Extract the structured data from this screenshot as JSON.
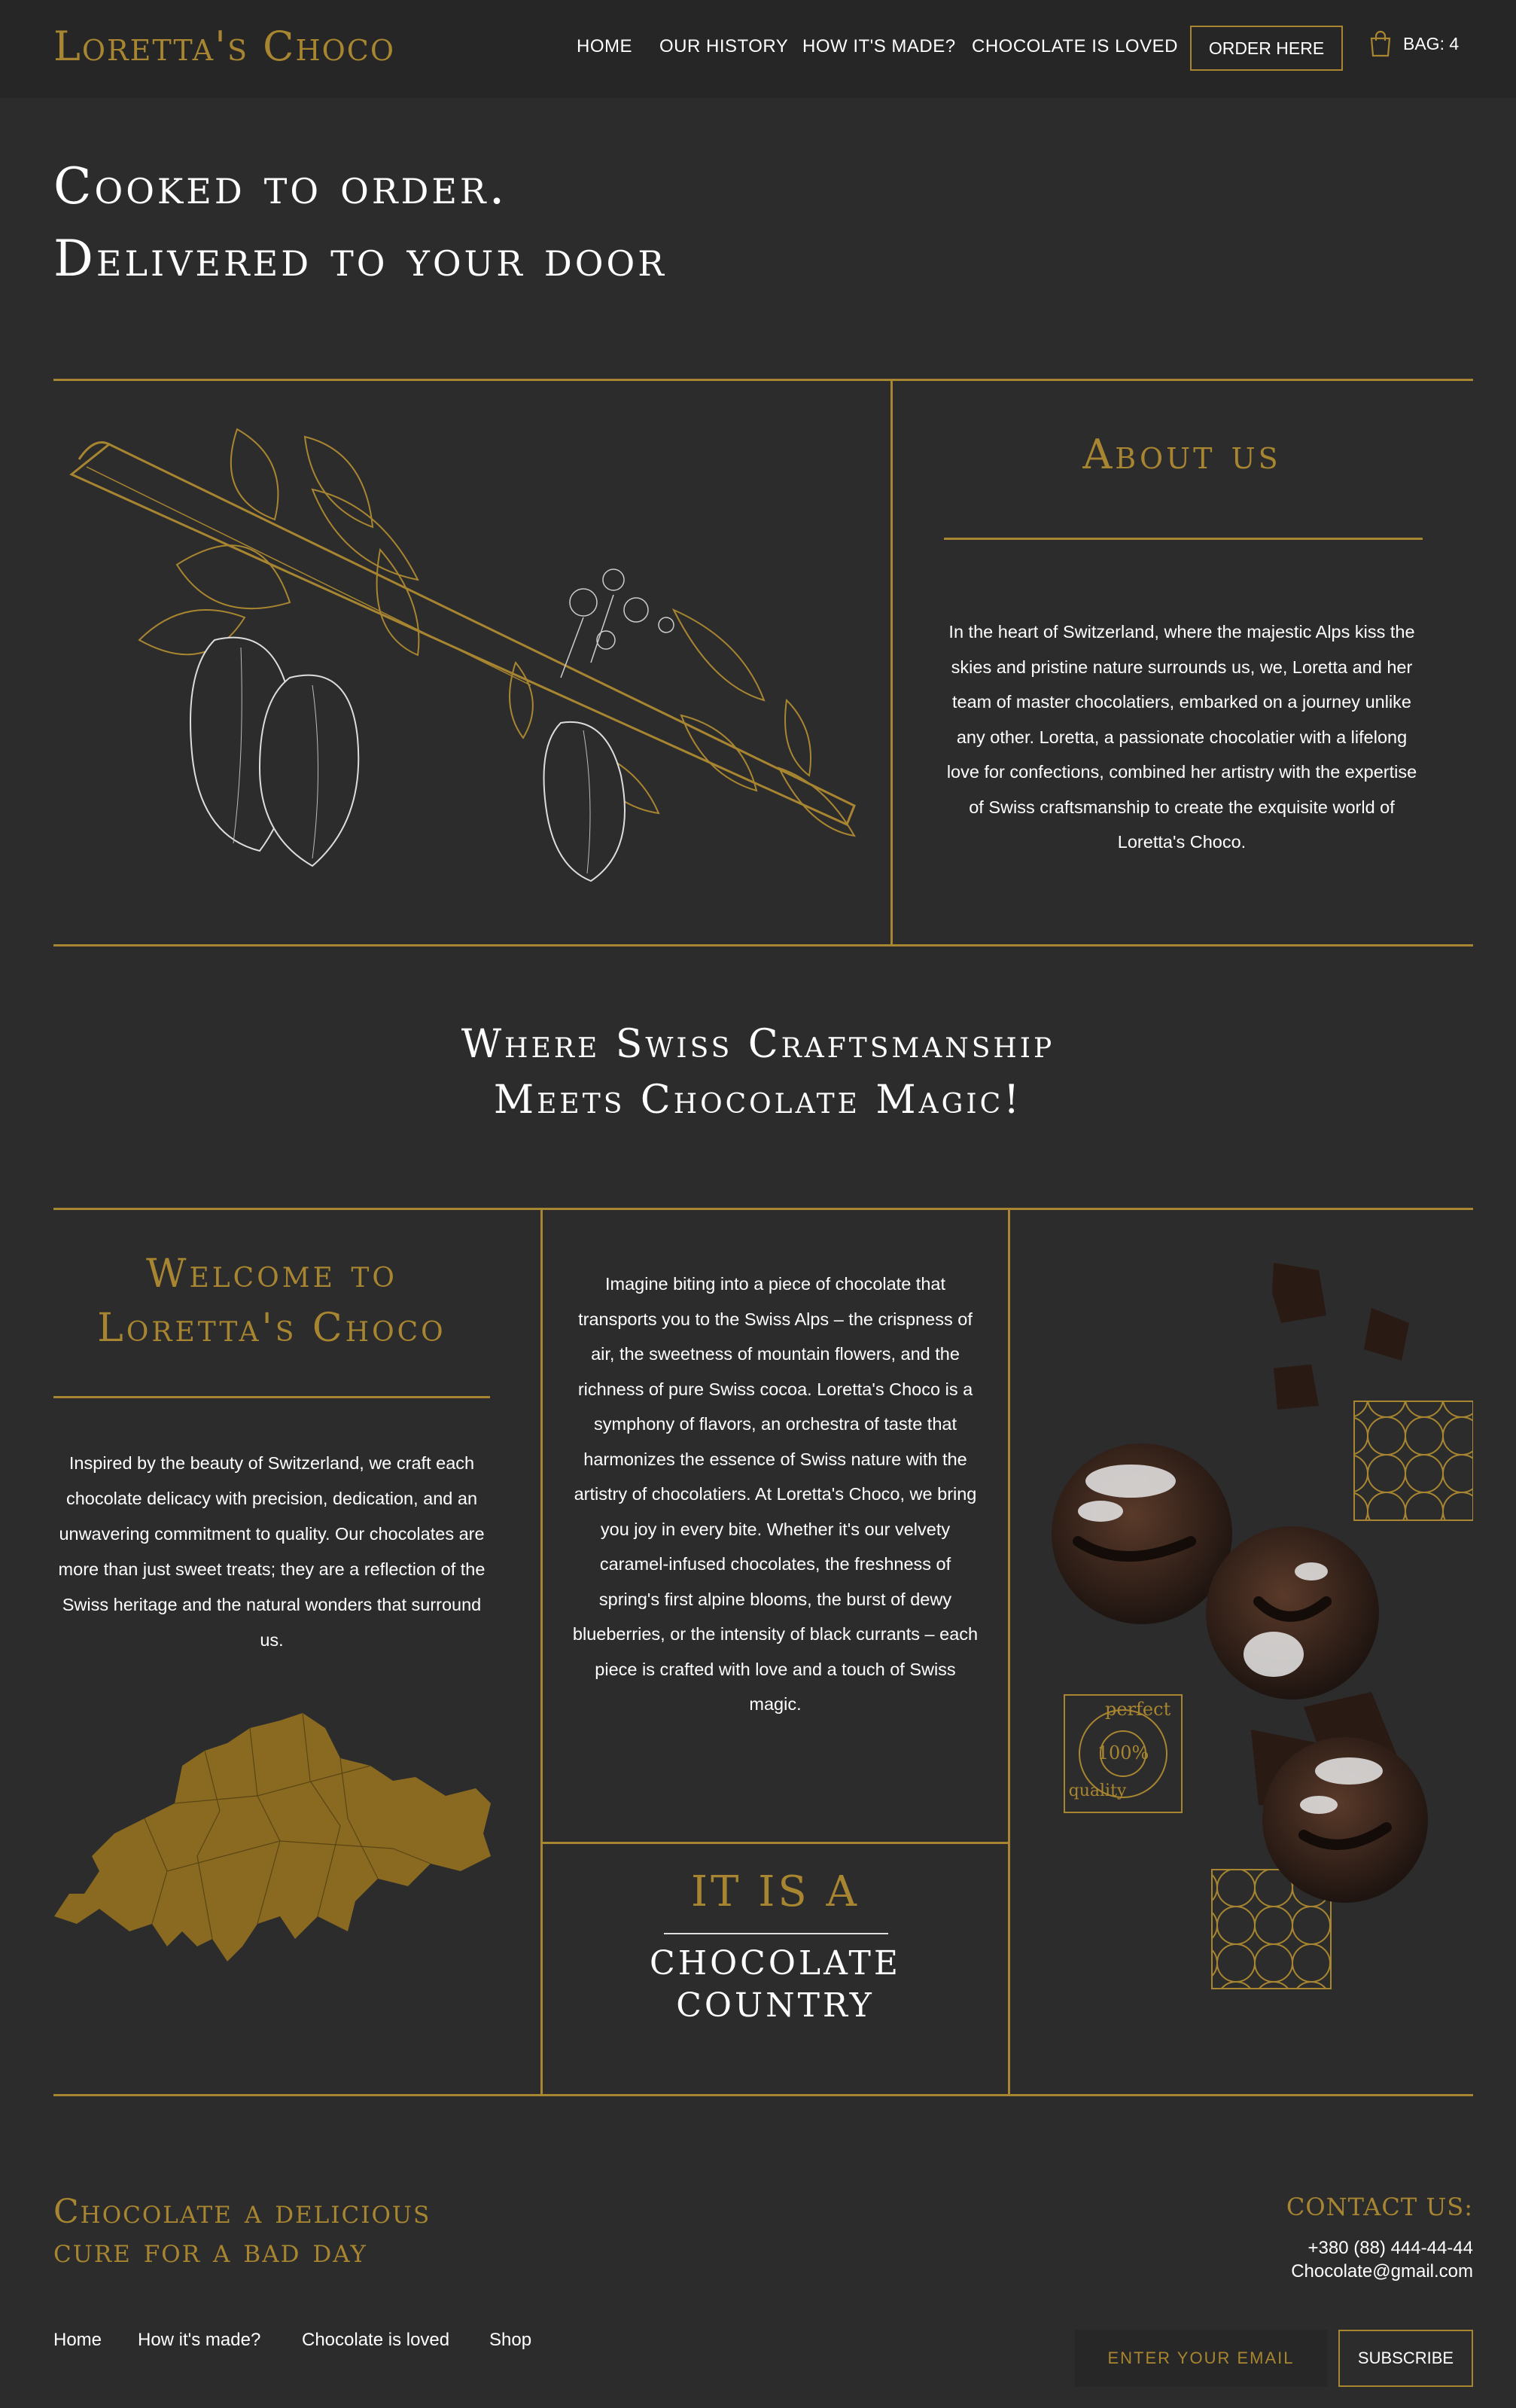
{
  "brand": {
    "logo": "Loretta's Choco"
  },
  "nav": {
    "items": [
      "HOME",
      "OUR HISTORY",
      "HOW IT'S MADE?",
      "CHOCOLATE IS LOVED"
    ],
    "active_index": 1,
    "order_label": "ORDER HERE",
    "bag_label": "BAG: 4"
  },
  "hero": {
    "line1": "Cooked to order.",
    "line2": "Delivered to your door"
  },
  "about": {
    "title": "About us",
    "text": "In the heart of Switzerland, where the majestic Alps kiss the skies and pristine nature surrounds us, we, Loretta and her team of master chocolatiers, embarked on a journey unlike any other. Loretta, a passionate chocolatier with a lifelong love for confections, combined her artistry with the expertise of Swiss craftsmanship to create the exquisite world of Loretta's Choco."
  },
  "slogan": {
    "line1": "Where Swiss Craftsmanship",
    "line2": "Meets Chocolate Magic!"
  },
  "welcome": {
    "line1": "Welcome to",
    "line2": "Loretta's Choco",
    "text": "Inspired by the beauty of Switzerland, we craft each chocolate delicacy with precision, dedication, and an unwavering commitment to quality. Our chocolates are more than just sweet treats; they are a reflection of the Swiss heritage and the natural wonders that surround us."
  },
  "story": {
    "text": "Imagine biting into a piece of chocolate that transports you to the Swiss Alps – the crispness of air, the sweetness of mountain flowers, and the richness of pure Swiss cocoa. Loretta's Choco is a symphony of flavors, an orchestra of taste that harmonizes the essence of Swiss nature with the artistry of chocolatiers. At Loretta's Choco, we bring you joy in every bite. Whether it's our velvety caramel-infused chocolates, the freshness of spring's first alpine blooms, the burst of dewy blueberries, or the intensity of black currants – each piece is crafted with love and a touch of Swiss magic."
  },
  "country": {
    "line1": "IT IS A",
    "line2": "CHOCOLATE",
    "line3": "COUNTRY"
  },
  "badge": {
    "top": "perfect",
    "center": "100%",
    "bottom": "quality"
  },
  "footer": {
    "title_line1": "Chocolate a delicious",
    "title_line2": "cure for a bad day",
    "contact_label": "CONTACT US:",
    "phone": "+380 (88) 444-44-44",
    "email": "Chocolate@gmail.com",
    "links": [
      "Home",
      "How it's made?",
      "Chocolate is loved",
      "Shop"
    ],
    "email_placeholder": "ENTER YOUR EMAIL",
    "subscribe_label": "SUBSCRIBE"
  },
  "colors": {
    "background": "#2c2c2c",
    "header": "#262626",
    "accent": "#a88530",
    "text": "#ffffff"
  }
}
